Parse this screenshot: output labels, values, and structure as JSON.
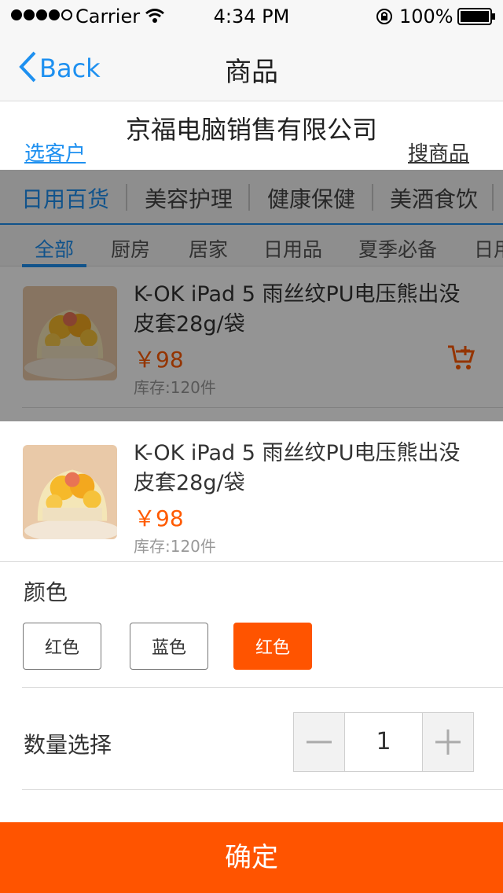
{
  "status_bar": {
    "carrier": "Carrier",
    "time": "4:34 PM",
    "battery": "100%"
  },
  "nav": {
    "back_label": "Back",
    "title": "商品"
  },
  "store": {
    "company": "京福电脑销售有限公司",
    "select_customer": "选客户",
    "search_products": "搜商品"
  },
  "categories": [
    "日用百货",
    "美容护理",
    "健康保健",
    "美酒食饮"
  ],
  "subcategories": [
    "全部",
    "厨房",
    "居家",
    "日用品",
    "夏季必备",
    "日用"
  ],
  "product": {
    "name_line1": "K-OK iPad 5 雨丝纹PU电压熊出没",
    "name_line2": "皮套28g/袋",
    "price": "￥98",
    "stock": "库存:120件"
  },
  "sheet": {
    "color_label": "颜色",
    "colors": [
      "红色",
      "蓝色",
      "红色"
    ],
    "selected_color_index": 2,
    "quantity_label": "数量选择",
    "quantity": "1",
    "confirm_label": "确定"
  },
  "colors": {
    "accent_blue": "#1e90f0",
    "accent_orange": "#ff5400"
  }
}
